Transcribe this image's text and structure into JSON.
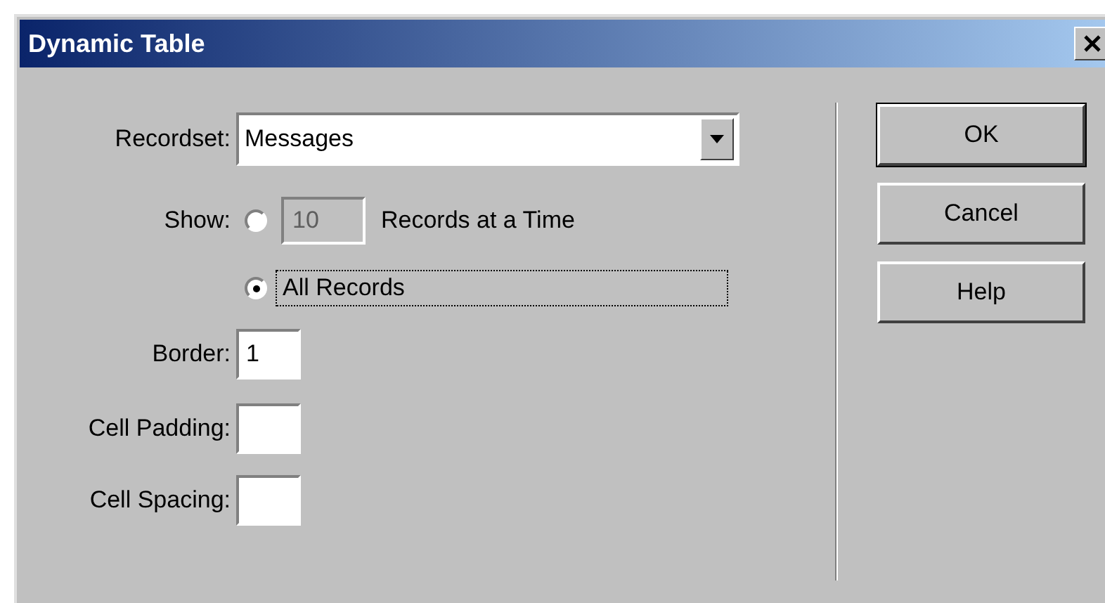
{
  "window": {
    "title": "Dynamic Table"
  },
  "recordset": {
    "label": "Recordset:",
    "value": "Messages"
  },
  "show": {
    "label": "Show:",
    "options": [
      {
        "kind": "count",
        "selected": false,
        "value": "10",
        "disabled": true,
        "text": "Records at a Time"
      },
      {
        "kind": "plain",
        "selected": true,
        "focused": true,
        "text": "All Records"
      }
    ]
  },
  "fields": [
    {
      "label": "Border:",
      "value": "1"
    },
    {
      "label": "Cell Padding:"
    },
    {
      "label": "Cell Spacing:"
    }
  ],
  "buttons": [
    {
      "label": "OK",
      "default": true
    },
    {
      "label": "Cancel",
      "default": false
    },
    {
      "label": "Help",
      "default": false
    }
  ]
}
